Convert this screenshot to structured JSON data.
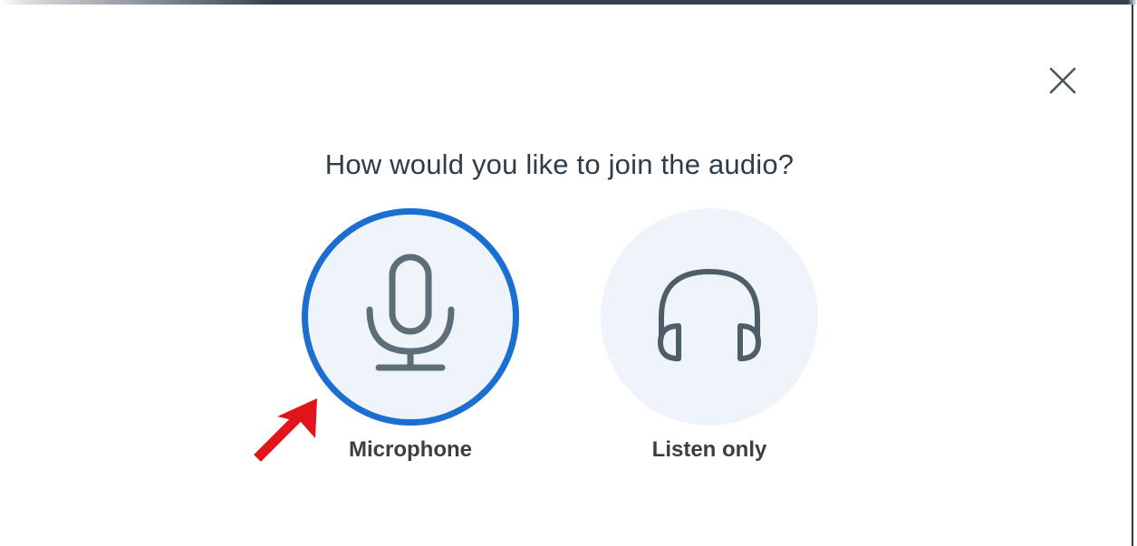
{
  "dialog": {
    "title": "How would you like to join the audio?",
    "close_icon": "close-icon"
  },
  "options": [
    {
      "id": "microphone",
      "label": "Microphone",
      "icon": "microphone-icon",
      "selected": true
    },
    {
      "id": "listen-only",
      "label": "Listen only",
      "icon": "headphones-icon",
      "selected": false
    }
  ],
  "annotation": {
    "icon": "red-arrow-icon",
    "points_to": "microphone"
  },
  "colors": {
    "accent": "#1a6fd1",
    "option_bg": "#eef4fa",
    "icon_stroke": "#5e6e79",
    "text": "#2f3d4a",
    "annotation": "#e0141b"
  }
}
